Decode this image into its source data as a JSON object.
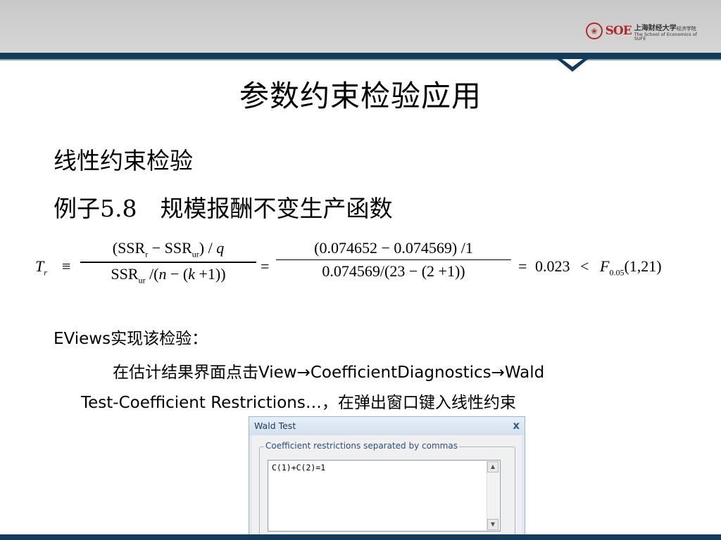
{
  "slide": {
    "title": "参数约束检验应用",
    "line1": "线性约束检验",
    "line2": "例子5.8　规模报酬不变生产函数"
  },
  "logo": {
    "seal": "❀",
    "mark": "SOE",
    "cn": "上海财经大学",
    "cn_small": "经济学院",
    "en": "The School of Economics of SUFE"
  },
  "formula": {
    "lhs_T": "T",
    "lhs_sub": "r",
    "equiv": "≡",
    "num1_a": "(SSR",
    "num1_a_sub": "r",
    "num1_minus": " − SSR",
    "num1_b_sub": "ur",
    "num1_tail": ") / ",
    "num1_q": "q",
    "den1_a": "SSR",
    "den1_sub": "ur",
    "den1_mid": " /(",
    "den1_n": "n",
    "den1_mid2": " − (",
    "den1_k": "k",
    "den1_tail": " +1))",
    "eq1": "=",
    "num2": "(0.074652 − 0.074569) /1",
    "den2": "0.074569/(23 − (2 +1))",
    "eq2": "=",
    "result": "0.023",
    "lt": "<",
    "F": "F",
    "F_sub": "0.05",
    "F_args": "(1,21)"
  },
  "eviews": {
    "line1_a": "EViews",
    "line1_b": "实现该检验：",
    "line2_cn": "在估计结果界面点击",
    "line2_path": "View→CoefficientDiagnostics→Wald",
    "line3_en": "Test-Coefficient Restrictions…",
    "line3_cn": "，在弹出窗口键入线性约束"
  },
  "dialog": {
    "title": "Wald Test",
    "close": "x",
    "group_label": "Coefficient restrictions separated by commas",
    "restrictions": "C(1)+C(2)=1",
    "scroll_up": "▲",
    "scroll_down": "▼"
  }
}
